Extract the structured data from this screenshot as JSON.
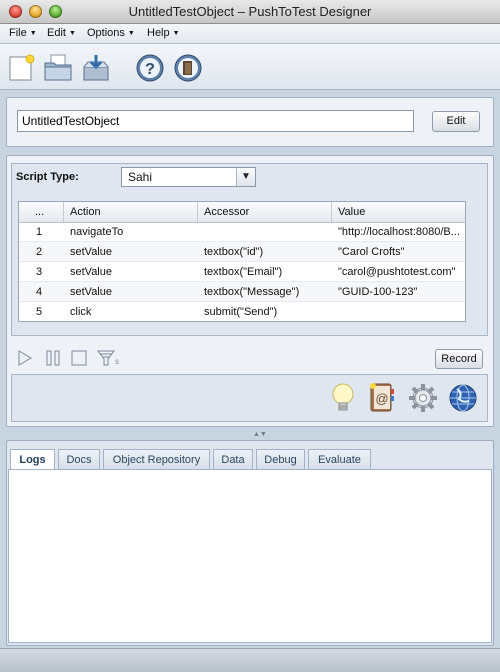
{
  "window": {
    "title": "UntitledTestObject – PushToTest Designer"
  },
  "menubar": {
    "items": [
      "File",
      "Edit",
      "Options",
      "Help"
    ]
  },
  "toolbar": {
    "buttons": [
      "new-document-icon",
      "open-folder-icon",
      "save-icon",
      "help-icon",
      "exit-icon"
    ]
  },
  "header": {
    "object_name": "UntitledTestObject",
    "edit_label": "Edit"
  },
  "script": {
    "type_label": "Script Type:",
    "type_value": "Sahi"
  },
  "table": {
    "columns": [
      "...",
      "Action",
      "Accessor",
      "Value"
    ],
    "rows": [
      [
        "1",
        "navigateTo",
        "",
        "\"http://localhost:8080/B..."
      ],
      [
        "2",
        "setValue",
        "textbox(\"id\")",
        "\"Carol Crofts\""
      ],
      [
        "3",
        "setValue",
        "textbox(\"Email\")",
        "\"carol@pushtotest.com\""
      ],
      [
        "4",
        "setValue",
        "textbox(\"Message\")",
        "\"GUID-100-123\""
      ],
      [
        "5",
        "click",
        "submit(\"Send\")",
        ""
      ]
    ]
  },
  "player": {
    "record_label": "Record"
  },
  "tools": {
    "icons": [
      "lightbulb-icon",
      "address-book-icon",
      "gear-icon",
      "globe-icon"
    ]
  },
  "bottom_tabs": [
    "Logs",
    "Docs",
    "Object Repository",
    "Data",
    "Debug",
    "Evaluate"
  ],
  "active_tab": "Logs"
}
